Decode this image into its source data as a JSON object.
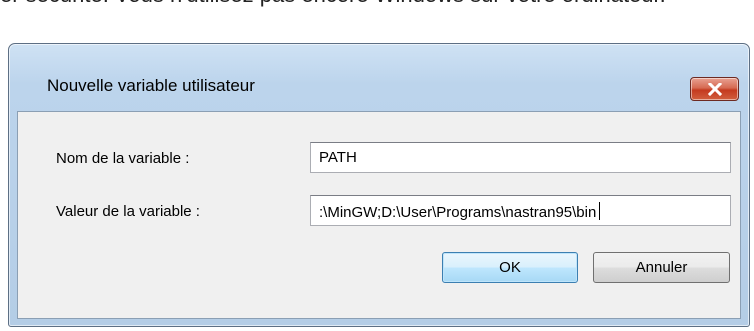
{
  "background_text": "er sécurité. Vous n'utilisez pas encore Windows sur votre ordinateur.",
  "window": {
    "title": "Nouvelle variable utilisateur"
  },
  "form": {
    "name_label": "Nom de la variable :",
    "name_value": "PATH",
    "value_label": "Valeur de la variable :",
    "value_value": ":\\MinGW;D:\\User\\Programs\\nastran95\\bin"
  },
  "buttons": {
    "ok_label": "OK",
    "cancel_label": "Annuler"
  },
  "colors": {
    "close_button": "#c43a1f",
    "window_frame": "#b4cde6",
    "default_button_border": "#3c7fb1"
  },
  "icons": {
    "close": "close-icon"
  }
}
